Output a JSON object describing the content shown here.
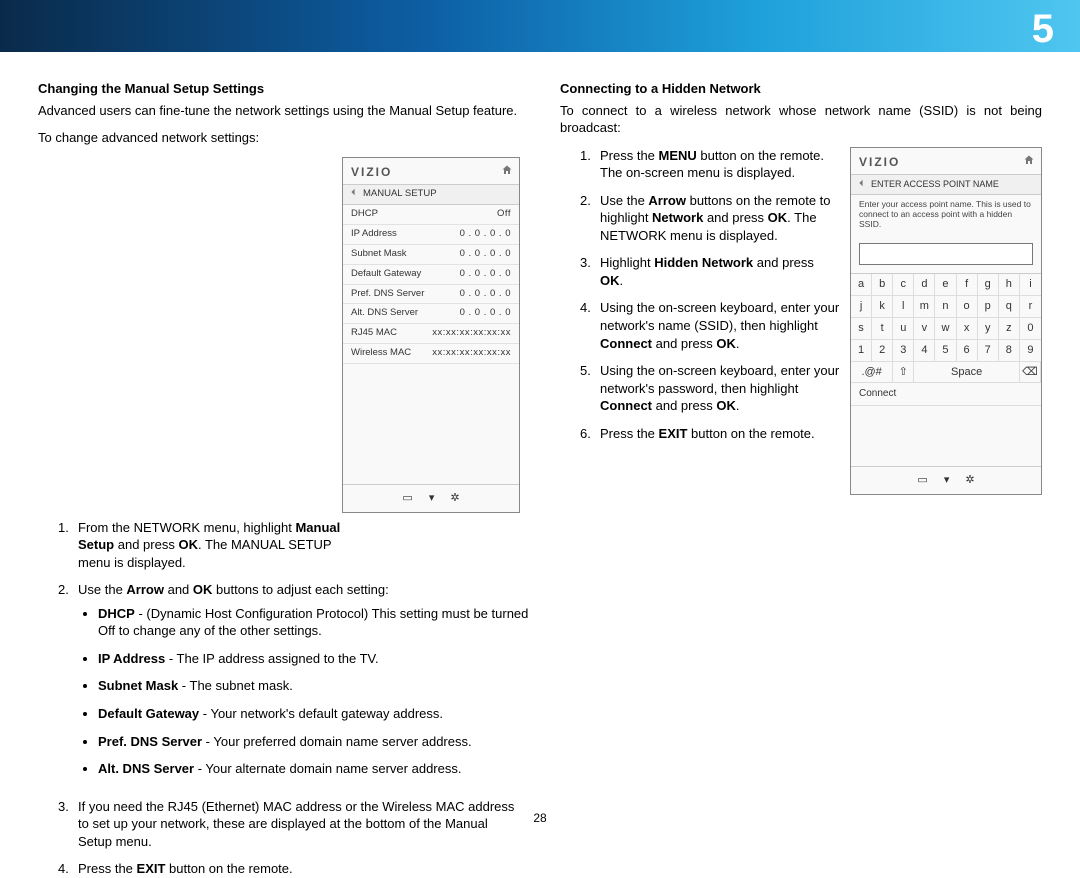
{
  "chapter": "5",
  "page_number": "28",
  "left": {
    "heading": "Changing the Manual Setup Settings",
    "intro": "Advanced users can fine-tune the network settings using the Manual Setup feature.",
    "lead": "To change advanced network settings:",
    "step1_a": "From the NETWORK menu, highlight ",
    "step1_b": "Manual Setup",
    "step1_c": " and press ",
    "step1_d": "OK",
    "step1_e": ". The MANUAL SETUP menu is displayed.",
    "step2_a": "Use the ",
    "step2_b": "Arrow",
    "step2_c": " and ",
    "step2_d": "OK",
    "step2_e": " buttons to adjust each setting:",
    "bullets": {
      "dhcp_t": "DHCP",
      "dhcp_d": " - (Dynamic Host Configuration Protocol) This setting must be turned Off to change any of the other settings.",
      "ip_t": "IP Address",
      "ip_d": " - The IP address assigned to the TV.",
      "subnet_t": "Subnet Mask",
      "subnet_d": " - The subnet mask.",
      "gw_t": "Default Gateway",
      "gw_d": " - Your network's default gateway address.",
      "pdns_t": "Pref. DNS Server",
      "pdns_d": " - Your preferred domain name server address.",
      "adns_t": "Alt. DNS Server",
      "adns_d": " - Your alternate domain name server address."
    },
    "step3": "If you need the RJ45 (Ethernet) MAC address or the Wireless MAC address to set up your network, these are displayed at the bottom of the Manual Setup menu.",
    "step4_a": "Press the ",
    "step4_b": "EXIT",
    "step4_c": " button on the remote."
  },
  "fig1": {
    "brand": "VIZIO",
    "crumb": "MANUAL SETUP",
    "rows": [
      {
        "k": "DHCP",
        "v": "Off"
      },
      {
        "k": "IP Address",
        "v": "0  . 0  . 0  . 0"
      },
      {
        "k": "Subnet Mask",
        "v": "0  . 0  . 0  . 0"
      },
      {
        "k": "Default Gateway",
        "v": "0  . 0  . 0  . 0"
      },
      {
        "k": "Pref. DNS Server",
        "v": "0  . 0  . 0  . 0"
      },
      {
        "k": "Alt. DNS Server",
        "v": "0  . 0  . 0  . 0"
      },
      {
        "k": "RJ45 MAC",
        "v": "xx:xx:xx:xx:xx:xx"
      },
      {
        "k": "Wireless MAC",
        "v": "xx:xx:xx:xx:xx:xx"
      }
    ]
  },
  "right": {
    "heading": "Connecting to a Hidden Network",
    "intro": "To connect to a wireless network whose network name (SSID) is not being broadcast:",
    "s1_a": "Press the ",
    "s1_b": "MENU",
    "s1_c": " button on the remote. The on-screen menu is displayed.",
    "s2_a": "Use the ",
    "s2_b": "Arrow",
    "s2_c": " buttons on the remote to highlight ",
    "s2_d": "Network",
    "s2_e": " and press ",
    "s2_f": "OK",
    "s2_g": ". The NETWORK menu is displayed.",
    "s3_a": "Highlight ",
    "s3_b": "Hidden Network",
    "s3_c": " and press ",
    "s3_d": "OK",
    "s3_e": ".",
    "s4_a": "Using the on-screen keyboard, enter your network's name (SSID), then highlight ",
    "s4_b": "Connect",
    "s4_c": " and press ",
    "s4_d": "OK",
    "s4_e": ".",
    "s5_a": "Using the on-screen keyboard, enter your network's password, then highlight ",
    "s5_b": "Connect",
    "s5_c": " and press ",
    "s5_d": "OK",
    "s5_e": ".",
    "s6_a": "Press the ",
    "s6_b": "EXIT",
    "s6_c": " button on the remote."
  },
  "fig2": {
    "brand": "VIZIO",
    "crumb": "ENTER ACCESS POINT NAME",
    "hint": "Enter your access point name. This is used to connect to an access point with a hidden SSID.",
    "keys_row1": [
      "a",
      "b",
      "c",
      "d",
      "e",
      "f",
      "g",
      "h",
      "i"
    ],
    "keys_row2": [
      "j",
      "k",
      "l",
      "m",
      "n",
      "o",
      "p",
      "q",
      "r"
    ],
    "keys_row3": [
      "s",
      "t",
      "u",
      "v",
      "w",
      "x",
      "y",
      "z",
      "0"
    ],
    "keys_row4": [
      "1",
      "2",
      "3",
      "4",
      "5",
      "6",
      "7",
      "8",
      "9"
    ],
    "sym": ".@#",
    "shift": "⇧",
    "space": "Space",
    "bksp": "⌫",
    "connect": "Connect"
  }
}
